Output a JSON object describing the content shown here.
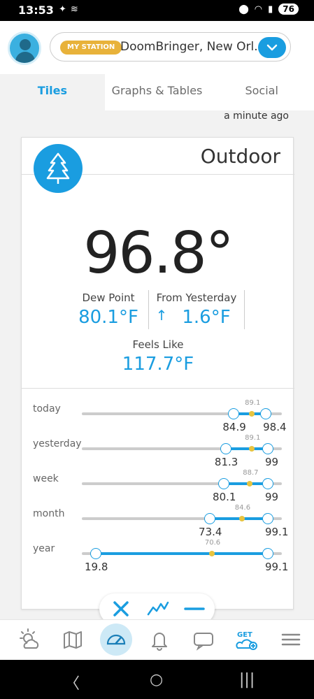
{
  "status_bar": {
    "time": "13:53",
    "battery": "76"
  },
  "header": {
    "station_badge": "MY STATION",
    "station_name": "DoomBringer, New Orl..."
  },
  "tabs": [
    {
      "label": "Tiles"
    },
    {
      "label": "Graphs & Tables"
    },
    {
      "label": "Social"
    }
  ],
  "updated": "a minute ago",
  "card": {
    "title": "Outdoor",
    "icon": "tree-icon",
    "temperature": "96.8°",
    "dew_point": {
      "label": "Dew Point",
      "value": "80.1°F"
    },
    "from_yesterday": {
      "label": "From Yesterday",
      "arrow": "↑",
      "value": "1.6°F"
    },
    "feels_like": {
      "label": "Feels Like",
      "value": "117.7°F"
    },
    "ranges": [
      {
        "label": "today",
        "low": "84.9",
        "avg": "89.1",
        "high": "98.4",
        "low_frac": 0.76,
        "avg_frac": 0.85,
        "high_frac": 0.92
      },
      {
        "label": "yesterday",
        "low": "81.3",
        "avg": "89.1",
        "high": "99",
        "low_frac": 0.72,
        "avg_frac": 0.85,
        "high_frac": 0.93
      },
      {
        "label": "week",
        "low": "80.1",
        "avg": "88.7",
        "high": "99",
        "low_frac": 0.71,
        "avg_frac": 0.84,
        "high_frac": 0.93
      },
      {
        "label": "month",
        "low": "73.4",
        "avg": "84.6",
        "high": "99.1",
        "low_frac": 0.64,
        "avg_frac": 0.8,
        "high_frac": 0.93
      },
      {
        "label": "year",
        "low": "19.8",
        "avg": "70.6",
        "high": "99.1",
        "low_frac": 0.07,
        "avg_frac": 0.65,
        "high_frac": 0.93
      }
    ]
  },
  "colors": {
    "accent": "#1a9de0",
    "badge": "#e8b23a",
    "avg_marker": "#e8c440"
  },
  "bottom_nav": [
    "weather-icon",
    "map-icon",
    "dashboard-icon",
    "bell-icon",
    "chat-icon",
    "get-station-icon",
    "menu-icon"
  ],
  "fab_bar": [
    "close-icon",
    "line-chart-icon",
    "minus-icon"
  ]
}
